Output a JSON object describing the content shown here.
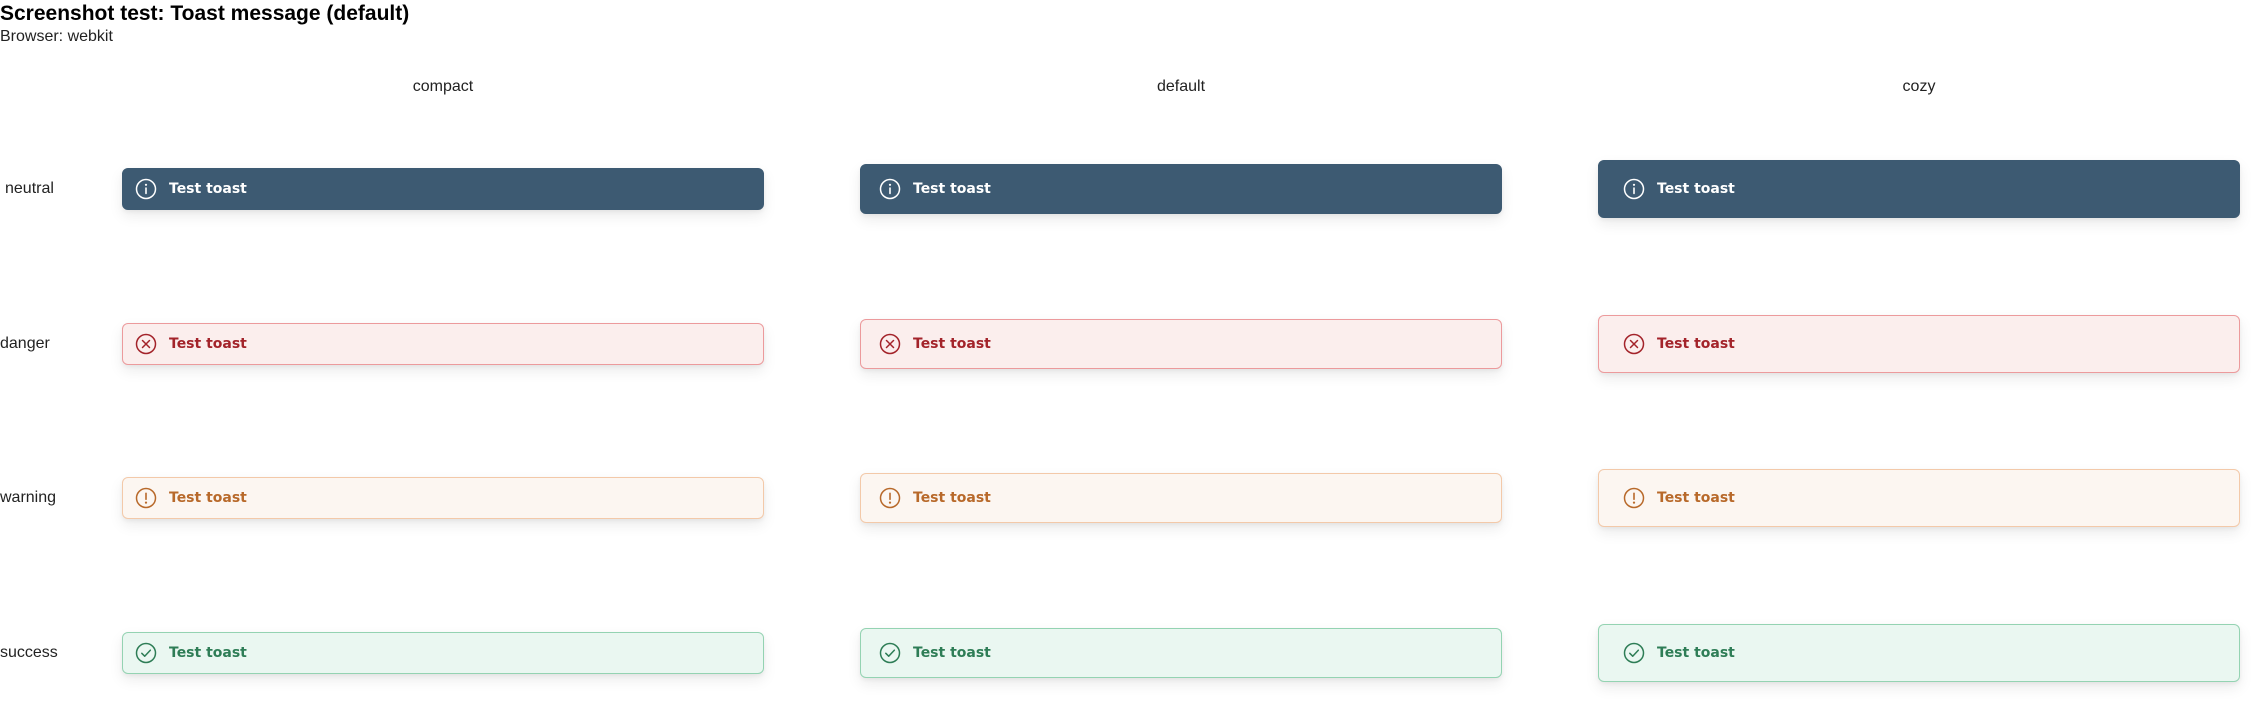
{
  "title": "Screenshot test: Toast message (default)",
  "browser": "Browser: webkit",
  "columns": [
    "compact",
    "default",
    "cozy"
  ],
  "rows": [
    "neutral",
    "danger",
    "warning",
    "success"
  ],
  "toast_text": "Test toast",
  "icons": {
    "neutral": "info-icon",
    "danger": "error-circle-icon",
    "warning": "exclamation-circle-icon",
    "success": "check-circle-icon"
  },
  "colors": {
    "neutral_bg": "#3d5a72",
    "danger_bg": "#fbeeed",
    "danger_text": "#a3232a",
    "warning_bg": "#fcf6f1",
    "warning_text": "#b8692a",
    "success_bg": "#eaf7f1",
    "success_text": "#2e7d56"
  }
}
